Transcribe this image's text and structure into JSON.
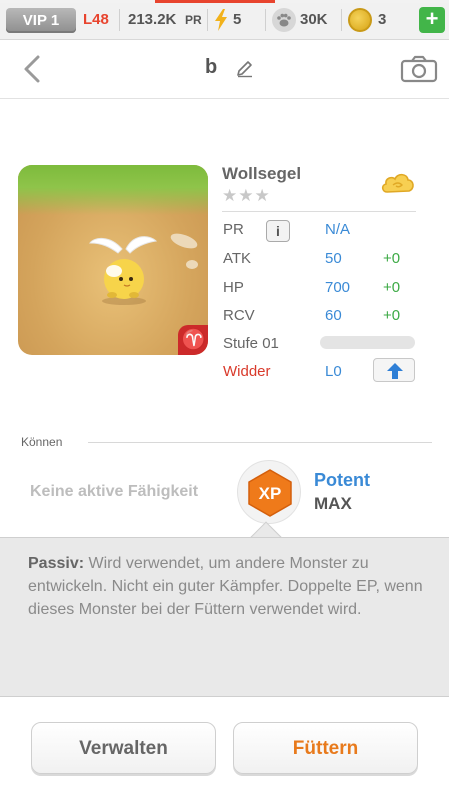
{
  "topbar": {
    "vip": "VIP 1",
    "level": "L48",
    "power_value": "213.2K",
    "power_label": "PR",
    "energy": "5",
    "food": "30K",
    "gems": "3",
    "add_label": "+",
    "colors": {
      "level": "#e8442e",
      "add": "#42b549"
    }
  },
  "header": {
    "monster_nickname": "b"
  },
  "monster": {
    "species": "Wollsegel",
    "stars": "★★★",
    "zodiac_symbol": "♈",
    "stats": {
      "pr_label": "PR",
      "pr_info": "i",
      "pr_value": "N/A",
      "atk_label": "ATK",
      "atk_value": "50",
      "atk_bonus": "+0",
      "hp_label": "HP",
      "hp_value": "700",
      "hp_bonus": "+0",
      "rcv_label": "RCV",
      "rcv_value": "60",
      "rcv_bonus": "+0",
      "level_label": "Stufe 01",
      "level_progress": 0.0,
      "zodiac_label": "Widder",
      "zodiac_level": "L0"
    }
  },
  "skills": {
    "section_label": "Können",
    "active": "Keine aktive Fähigkeit",
    "icon_text": "XP",
    "skill_name": "Potent",
    "skill_level": "MAX"
  },
  "passive": {
    "label": "Passiv:",
    "text": " Wird verwendet, um andere Monster zu entwickeln. Nicht ein guter Kämpfer. Doppelte EP, wenn dieses Monster bei der Füttern verwendet wird."
  },
  "buttons": {
    "manage": "Verwalten",
    "feed": "Füttern"
  }
}
